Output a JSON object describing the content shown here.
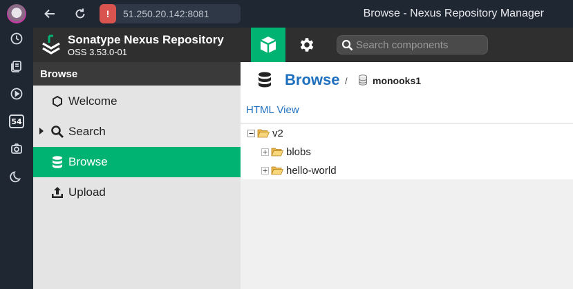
{
  "browser": {
    "url": "51.250.20.142:8081",
    "window_title": "Browse - Nexus Repository Manager",
    "sidebar_badge": "54",
    "icons": [
      "avatar",
      "history-icon",
      "tabs-icon",
      "play-icon",
      "badge-54-icon",
      "camera-icon",
      "moon-icon"
    ]
  },
  "app": {
    "name": "Sonatype Nexus Repository",
    "version": "OSS 3.53.0-01",
    "search_placeholder": "Search components",
    "accent_color": "#00b373"
  },
  "nav": {
    "header": "Browse",
    "items": [
      {
        "label": "Welcome",
        "icon": "hexagon-icon",
        "active": false
      },
      {
        "label": "Search",
        "icon": "search-icon",
        "active": false,
        "expandable": true
      },
      {
        "label": "Browse",
        "icon": "database-icon",
        "active": true
      },
      {
        "label": "Upload",
        "icon": "upload-icon",
        "active": false
      }
    ]
  },
  "content": {
    "title": "Browse",
    "breadcrumb_separator": "/",
    "repository": "monooks1",
    "html_view_link": "HTML View",
    "tree": [
      {
        "label": "v2",
        "level": 0,
        "expanded": true
      },
      {
        "label": "blobs",
        "level": 1,
        "expanded": false
      },
      {
        "label": "hello-world",
        "level": 1,
        "expanded": false
      }
    ]
  }
}
